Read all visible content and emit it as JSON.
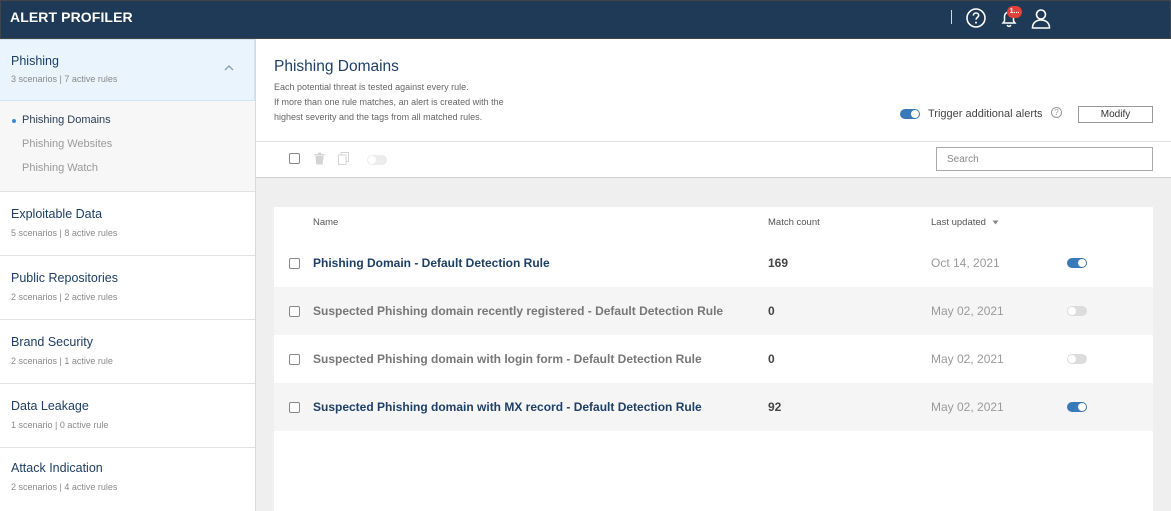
{
  "app": {
    "title": "ALERT PROFILER",
    "notification_count": "1..."
  },
  "sidebar": {
    "categories": [
      {
        "title": "Phishing",
        "subtitle": "3 scenarios | 7 active rules"
      },
      {
        "title": "Exploitable Data",
        "subtitle": "5 scenarios | 8 active rules"
      },
      {
        "title": "Public Repositories",
        "subtitle": "2 scenarios | 2 active rules"
      },
      {
        "title": "Brand Security",
        "subtitle": "2 scenarios | 1 active rule"
      },
      {
        "title": "Data Leakage",
        "subtitle": "1 scenario | 0 active rule"
      },
      {
        "title": "Attack Indication",
        "subtitle": "2 scenarios | 4 active rules"
      }
    ],
    "sub_items": [
      {
        "label": "Phishing Domains"
      },
      {
        "label": "Phishing Websites"
      },
      {
        "label": "Phishing Watch"
      }
    ]
  },
  "header": {
    "title": "Phishing Domains",
    "desc_lines": [
      "Each potential threat is tested against every rule.",
      "If more than one rule matches, an alert is created with the",
      "highest severity and the tags from all matched rules."
    ],
    "trigger_label": "Trigger additional alerts",
    "help_glyph": "?",
    "modify_label": "Modify"
  },
  "toolbar": {
    "search_placeholder": "Search"
  },
  "table": {
    "columns": {
      "name": "Name",
      "count": "Match count",
      "updated": "Last updated"
    },
    "rows": [
      {
        "name": "Phishing Domain - Default Detection Rule",
        "count": "169",
        "date": "Oct 14, 2021",
        "enabled": true
      },
      {
        "name": "Suspected Phishing domain recently registered - Default Detection Rule",
        "count": "0",
        "date": "May 02, 2021",
        "enabled": false
      },
      {
        "name": "Suspected Phishing domain with login form - Default Detection Rule",
        "count": "0",
        "date": "May 02, 2021",
        "enabled": false
      },
      {
        "name": "Suspected Phishing domain with MX record - Default Detection Rule",
        "count": "92",
        "date": "May 02, 2021",
        "enabled": true
      }
    ]
  }
}
